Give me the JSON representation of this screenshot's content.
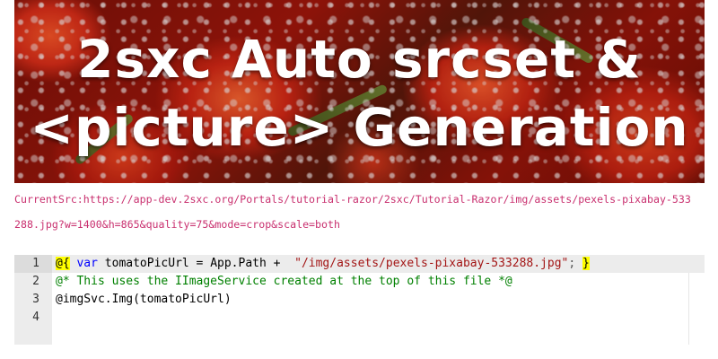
{
  "hero": {
    "title_line1": "2sxc Auto srcset &",
    "title_line2": "<picture> Generation",
    "image_description": "tomatoes-with-bubbles"
  },
  "current_src": {
    "label": "CurrentSrc:",
    "url": "https://app-dev.2sxc.org/Portals/tutorial-razor/2sxc/Tutorial-Razor/img/assets/pexels-pixabay-533288.jpg?w=1400&h=865&quality=75&mode=crop&scale=both"
  },
  "editor": {
    "line_numbers": [
      "1",
      "2",
      "3",
      "4"
    ],
    "line1": {
      "open": "@{",
      "keyword": "var",
      "decl": "tomatoPicUrl = App.Path +  ",
      "string": "\"/img/assets/pexels-pixabay-533288.jpg\"",
      "semi": ";",
      "close": "}"
    },
    "line2": {
      "comment": "@* This uses the IImageService created at the top of this file *@"
    },
    "line3": {
      "code": "@imgSvc.Img(tomatoPicUrl)"
    },
    "line4": {
      "code": ""
    }
  },
  "colors": {
    "link_pink": "#c9306f",
    "keyword_blue": "#0000ff",
    "string_red": "#a31515",
    "comment_green": "#008000",
    "highlight_yellow": "#ffff00"
  }
}
